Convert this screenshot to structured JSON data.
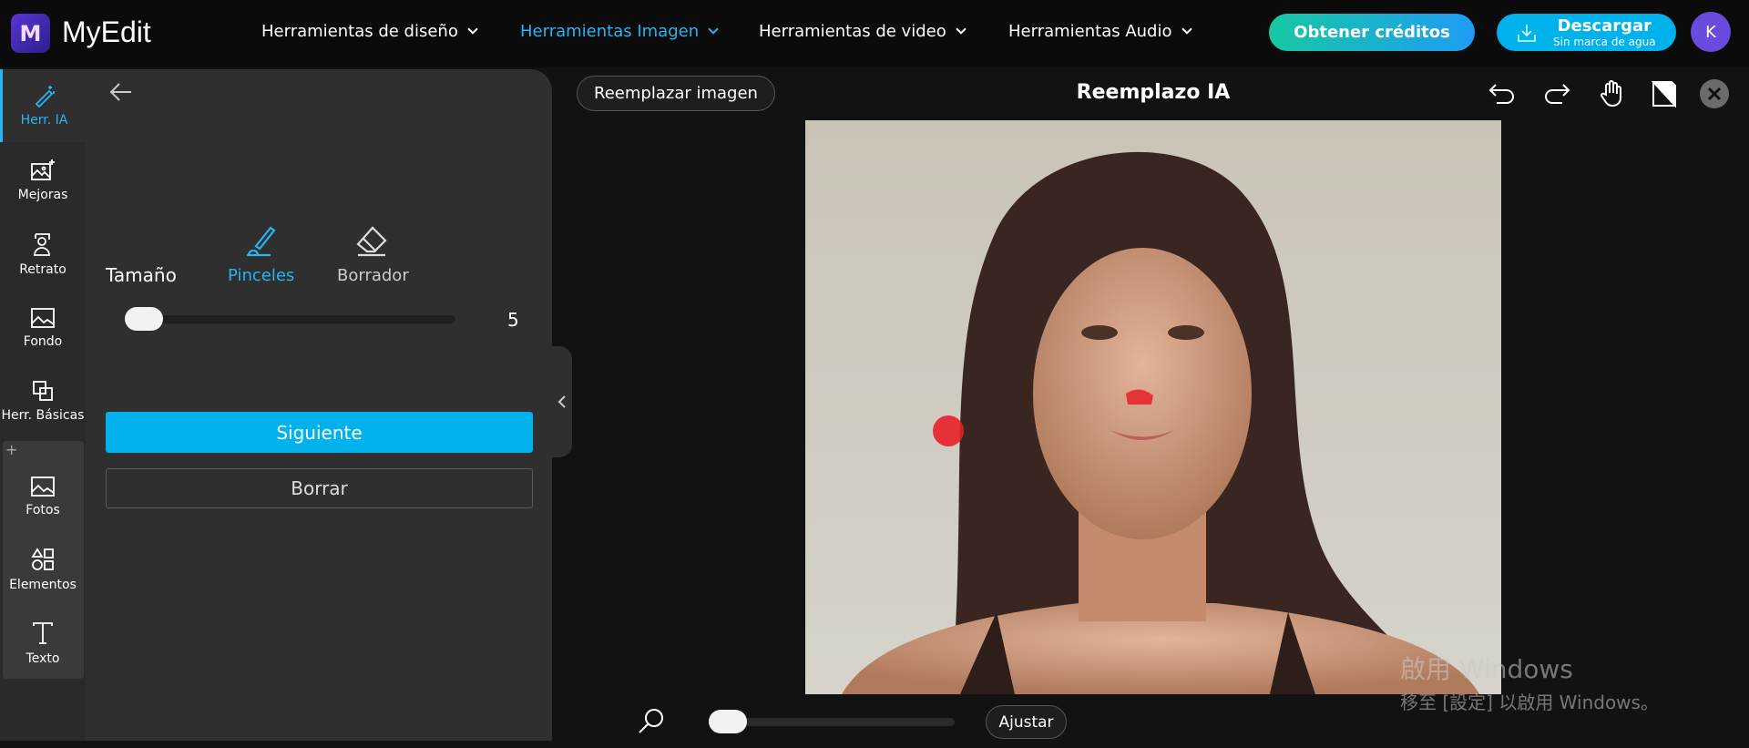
{
  "app": {
    "name": "MyEdit",
    "logo_letter": "M"
  },
  "nav": [
    {
      "label": "Herramientas de diseño",
      "active": false
    },
    {
      "label": "Herramientas Imagen",
      "active": true
    },
    {
      "label": "Herramientas de video",
      "active": false
    },
    {
      "label": "Herramientas Audio",
      "active": false
    }
  ],
  "header": {
    "credits_label": "Obtener créditos",
    "download_label": "Descargar",
    "download_sub": "Sin marca de agua",
    "avatar_initial": "K"
  },
  "rail": [
    {
      "label": "Herr. IA",
      "icon": "magic-wand-icon",
      "active": true
    },
    {
      "label": "Mejoras",
      "icon": "image-sparkle-icon"
    },
    {
      "label": "Retrato",
      "icon": "portrait-icon"
    },
    {
      "label": "Fondo",
      "icon": "background-icon"
    },
    {
      "label": "Herr. Básicas",
      "icon": "crop-icon"
    },
    {
      "label": "Fotos",
      "icon": "photo-icon"
    },
    {
      "label": "Elementos",
      "icon": "shapes-icon"
    },
    {
      "label": "Texto",
      "icon": "text-icon"
    }
  ],
  "rail_add": "+",
  "panel": {
    "brush_label": "Pinceles",
    "eraser_label": "Borrador",
    "size_label": "Tamaño",
    "size_value": "5",
    "size_fraction": 0.0,
    "next_label": "Siguiente",
    "clear_label": "Borrar"
  },
  "canvas": {
    "replace_label": "Reemplazar imagen",
    "title": "Reemplazo IA",
    "fit_label": "Ajustar",
    "zoom_fraction": 0.0
  },
  "colors": {
    "accent": "#00b2ec",
    "brush_mark": "#e8202a"
  },
  "watermark": {
    "line1": "啟用 Windows",
    "line2": "移至 [設定] 以啟用 Windows。"
  }
}
